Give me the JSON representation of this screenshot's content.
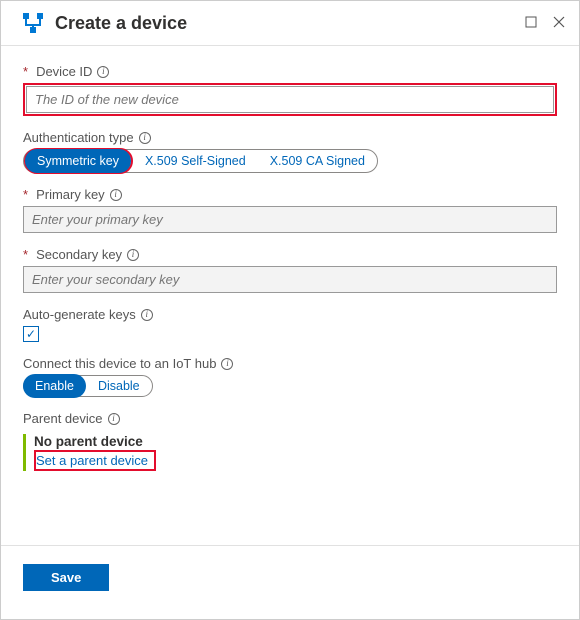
{
  "header": {
    "title": "Create a device"
  },
  "device_id": {
    "label": "Device ID",
    "placeholder": "The ID of the new device"
  },
  "auth_type": {
    "label": "Authentication type",
    "options": [
      "Symmetric key",
      "X.509 Self-Signed",
      "X.509 CA Signed"
    ],
    "selected": "Symmetric key"
  },
  "primary_key": {
    "label": "Primary key",
    "placeholder": "Enter your primary key"
  },
  "secondary_key": {
    "label": "Secondary key",
    "placeholder": "Enter your secondary key"
  },
  "autogen": {
    "label": "Auto-generate keys",
    "checked": true
  },
  "connect_hub": {
    "label": "Connect this device to an IoT hub",
    "options": [
      "Enable",
      "Disable"
    ],
    "selected": "Enable"
  },
  "parent_device": {
    "label": "Parent device",
    "value": "No parent device",
    "link": "Set a parent device"
  },
  "footer": {
    "save": "Save"
  }
}
